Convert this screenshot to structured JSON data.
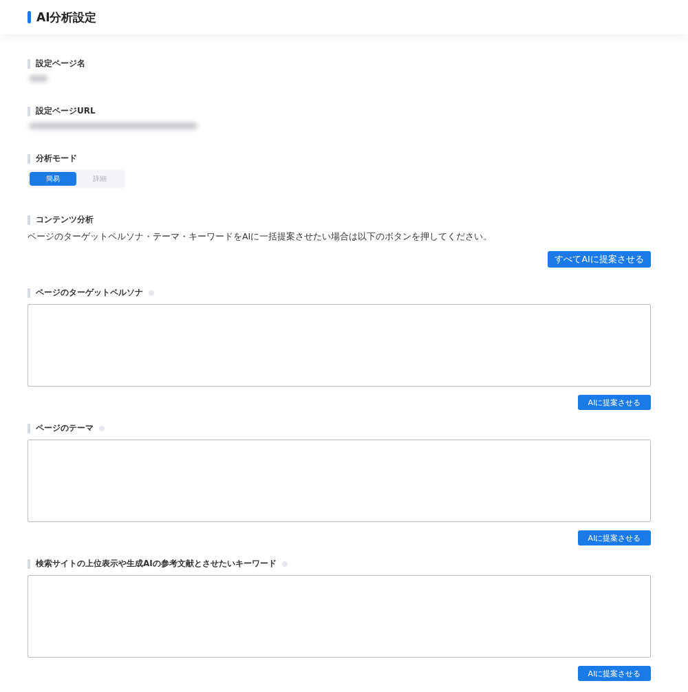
{
  "header": {
    "title": "AI分析設定"
  },
  "page_name": {
    "label": "設定ページ名"
  },
  "page_url": {
    "label": "設定ページURL"
  },
  "mode": {
    "label": "分析モード",
    "options": [
      {
        "label": "簡易",
        "selected": true
      },
      {
        "label": "詳細",
        "selected": false
      }
    ]
  },
  "content_analysis": {
    "label": "コンテンツ分析",
    "description": "ページのターゲットペルソナ・テーマ・キーワードをAIに一括提案させたい場合は以下のボタンを押してください。",
    "button": "すべてAIに提案させる"
  },
  "inputs": [
    {
      "label": "ページのターゲットペルソナ",
      "button": "AIに提案させる"
    },
    {
      "label": "ページのテーマ",
      "button": "AIに提案させる"
    },
    {
      "label": "検索サイトの上位表示や生成AIの参考文献とさせたいキーワード",
      "button": "AIに提案させる"
    }
  ]
}
